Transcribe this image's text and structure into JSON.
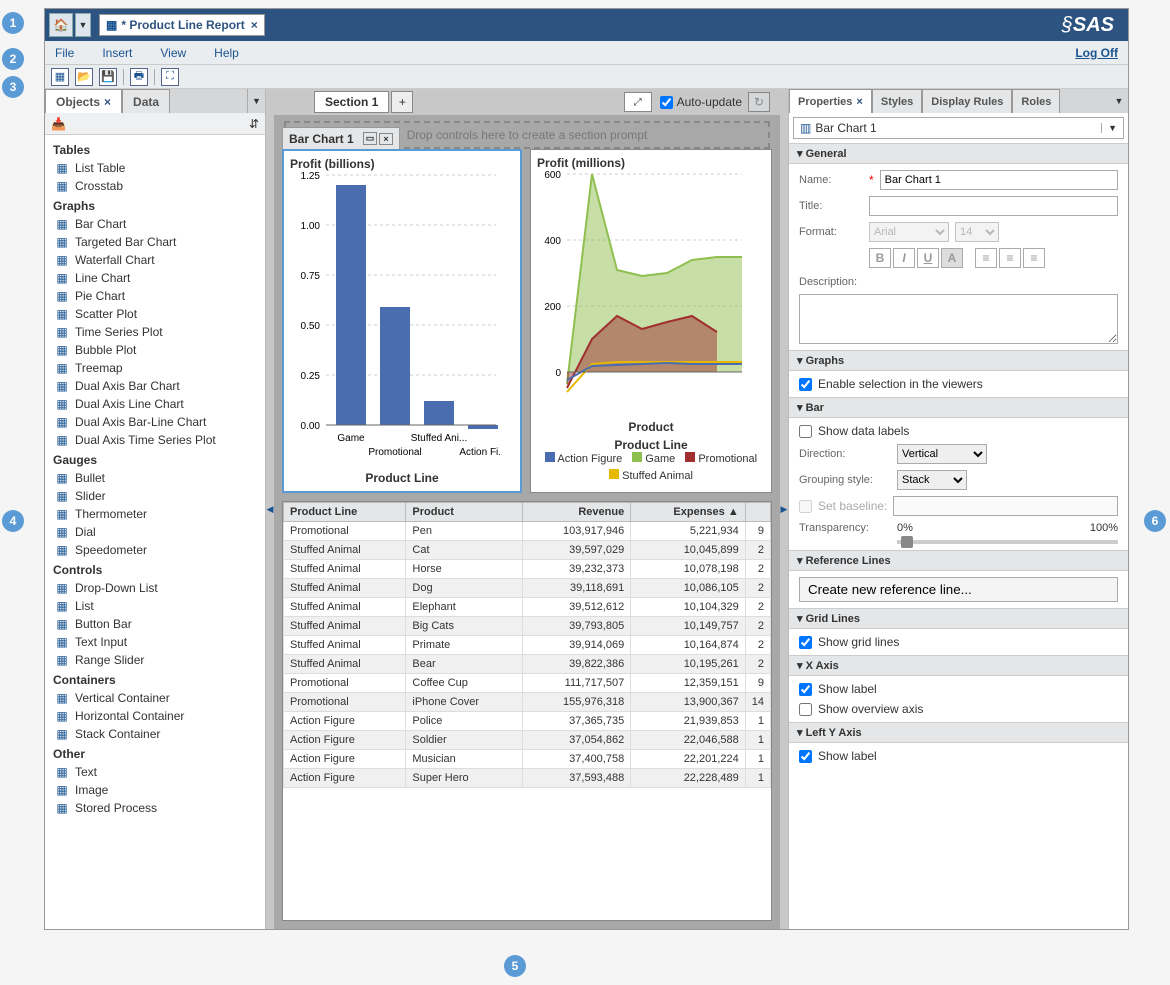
{
  "callouts": [
    "1",
    "2",
    "3",
    "4",
    "5",
    "6"
  ],
  "titlebar": {
    "doc_title": "* Product Line Report",
    "logo": "SAS"
  },
  "menubar": {
    "items": [
      "File",
      "Insert",
      "View",
      "Help"
    ],
    "logoff": "Log Off"
  },
  "left": {
    "tabs": [
      "Objects",
      "Data"
    ],
    "groups": [
      {
        "name": "Tables",
        "items": [
          "List Table",
          "Crosstab"
        ]
      },
      {
        "name": "Graphs",
        "items": [
          "Bar Chart",
          "Targeted Bar Chart",
          "Waterfall Chart",
          "Line Chart",
          "Pie Chart",
          "Scatter Plot",
          "Time Series Plot",
          "Bubble Plot",
          "Treemap",
          "Dual Axis Bar Chart",
          "Dual Axis Line Chart",
          "Dual Axis Bar-Line Chart",
          "Dual Axis Time Series Plot"
        ]
      },
      {
        "name": "Gauges",
        "items": [
          "Bullet",
          "Slider",
          "Thermometer",
          "Dial",
          "Speedometer"
        ]
      },
      {
        "name": "Controls",
        "items": [
          "Drop-Down List",
          "List",
          "Button Bar",
          "Text Input",
          "Range Slider"
        ]
      },
      {
        "name": "Containers",
        "items": [
          "Vertical Container",
          "Horizontal Container",
          "Stack Container"
        ]
      },
      {
        "name": "Other",
        "items": [
          "Text",
          "Image",
          "Stored Process"
        ]
      }
    ]
  },
  "center": {
    "section_tab": "Section 1",
    "auto_update": "Auto-update",
    "drop_hint": "Drop controls here to create a section prompt",
    "bar_chart_title": "Bar Chart 1",
    "bar_chart": {
      "ylabel": "Profit (billions)",
      "xlabel": "Product Line"
    },
    "line_chart": {
      "ylabel": "Profit (millions)",
      "xlabel": "Product",
      "legend_title": "Product Line",
      "legend": [
        "Action Figure",
        "Game",
        "Promotional",
        "Stuffed Animal"
      ]
    },
    "table": {
      "headers": [
        "Product Line",
        "Product",
        "Revenue",
        "Expenses"
      ],
      "rows": [
        [
          "Promotional",
          "Pen",
          "103,917,946",
          "5,221,934",
          "9"
        ],
        [
          "Stuffed Animal",
          "Cat",
          "39,597,029",
          "10,045,899",
          "2"
        ],
        [
          "Stuffed Animal",
          "Horse",
          "39,232,373",
          "10,078,198",
          "2"
        ],
        [
          "Stuffed Animal",
          "Dog",
          "39,118,691",
          "10,086,105",
          "2"
        ],
        [
          "Stuffed Animal",
          "Elephant",
          "39,512,612",
          "10,104,329",
          "2"
        ],
        [
          "Stuffed Animal",
          "Big Cats",
          "39,793,805",
          "10,149,757",
          "2"
        ],
        [
          "Stuffed Animal",
          "Primate",
          "39,914,069",
          "10,164,874",
          "2"
        ],
        [
          "Stuffed Animal",
          "Bear",
          "39,822,386",
          "10,195,261",
          "2"
        ],
        [
          "Promotional",
          "Coffee Cup",
          "111,717,507",
          "12,359,151",
          "9"
        ],
        [
          "Promotional",
          "iPhone Cover",
          "155,976,318",
          "13,900,367",
          "14"
        ],
        [
          "Action Figure",
          "Police",
          "37,365,735",
          "21,939,853",
          "1"
        ],
        [
          "Action Figure",
          "Soldier",
          "37,054,862",
          "22,046,588",
          "1"
        ],
        [
          "Action Figure",
          "Musician",
          "37,400,758",
          "22,201,224",
          "1"
        ],
        [
          "Action Figure",
          "Super Hero",
          "37,593,488",
          "22,228,489",
          "1"
        ]
      ]
    }
  },
  "right": {
    "tabs": [
      "Properties",
      "Styles",
      "Display Rules",
      "Roles"
    ],
    "selector": "Bar Chart 1",
    "general": {
      "header": "General",
      "name_label": "Name:",
      "name_value": "Bar Chart 1",
      "title_label": "Title:",
      "format_label": "Format:",
      "font": "Arial",
      "size": "14",
      "desc_label": "Description:"
    },
    "graphs": {
      "header": "Graphs",
      "enable_sel": "Enable selection in the viewers"
    },
    "bar": {
      "header": "Bar",
      "show_labels": "Show data labels",
      "direction_label": "Direction:",
      "direction_value": "Vertical",
      "grouping_label": "Grouping style:",
      "grouping_value": "Stack",
      "baseline_label": "Set baseline:",
      "transparency_label": "Transparency:",
      "t0": "0%",
      "t100": "100%"
    },
    "reflines": {
      "header": "Reference Lines",
      "create": "Create new reference line..."
    },
    "gridlines": {
      "header": "Grid Lines",
      "show": "Show grid lines"
    },
    "xaxis": {
      "header": "X Axis",
      "show_label": "Show label",
      "show_overview": "Show overview axis"
    },
    "lyaxis": {
      "header": "Left Y Axis",
      "show_label": "Show label"
    }
  },
  "chart_data": [
    {
      "type": "bar",
      "title": "Profit (billions)",
      "xlabel": "Product Line",
      "ylabel": "Profit (billions)",
      "categories": [
        "Game",
        "Promotional",
        "Stuffed Ani...",
        "Action Fi..."
      ],
      "values": [
        1.2,
        0.59,
        0.12,
        -0.02
      ],
      "ylim": [
        0,
        1.25
      ],
      "yticks": [
        0.0,
        0.25,
        0.5,
        0.75,
        1.0,
        1.25
      ]
    },
    {
      "type": "line",
      "title": "Profit (millions)",
      "xlabel": "Product",
      "ylabel": "Profit (millions)",
      "legend_title": "Product Line",
      "ylim": [
        -50,
        600
      ],
      "yticks": [
        0,
        200,
        400,
        600
      ],
      "x": [
        1,
        2,
        3,
        4,
        5,
        6,
        7,
        8
      ],
      "series": [
        {
          "name": "Action Figure",
          "color": "#4a6db0",
          "values": [
            10,
            15,
            18,
            20,
            22,
            20,
            20,
            20
          ]
        },
        {
          "name": "Game",
          "color": "#8fbf4f",
          "values": [
            -20,
            600,
            310,
            290,
            300,
            340,
            350,
            350
          ]
        },
        {
          "name": "Promotional",
          "color": "#a03030",
          "values": [
            -30,
            100,
            170,
            130,
            150,
            170,
            120,
            null
          ]
        },
        {
          "name": "Stuffed Animal",
          "color": "#e6b800",
          "values": [
            -40,
            25,
            30,
            30,
            30,
            30,
            30,
            30
          ]
        }
      ]
    }
  ]
}
